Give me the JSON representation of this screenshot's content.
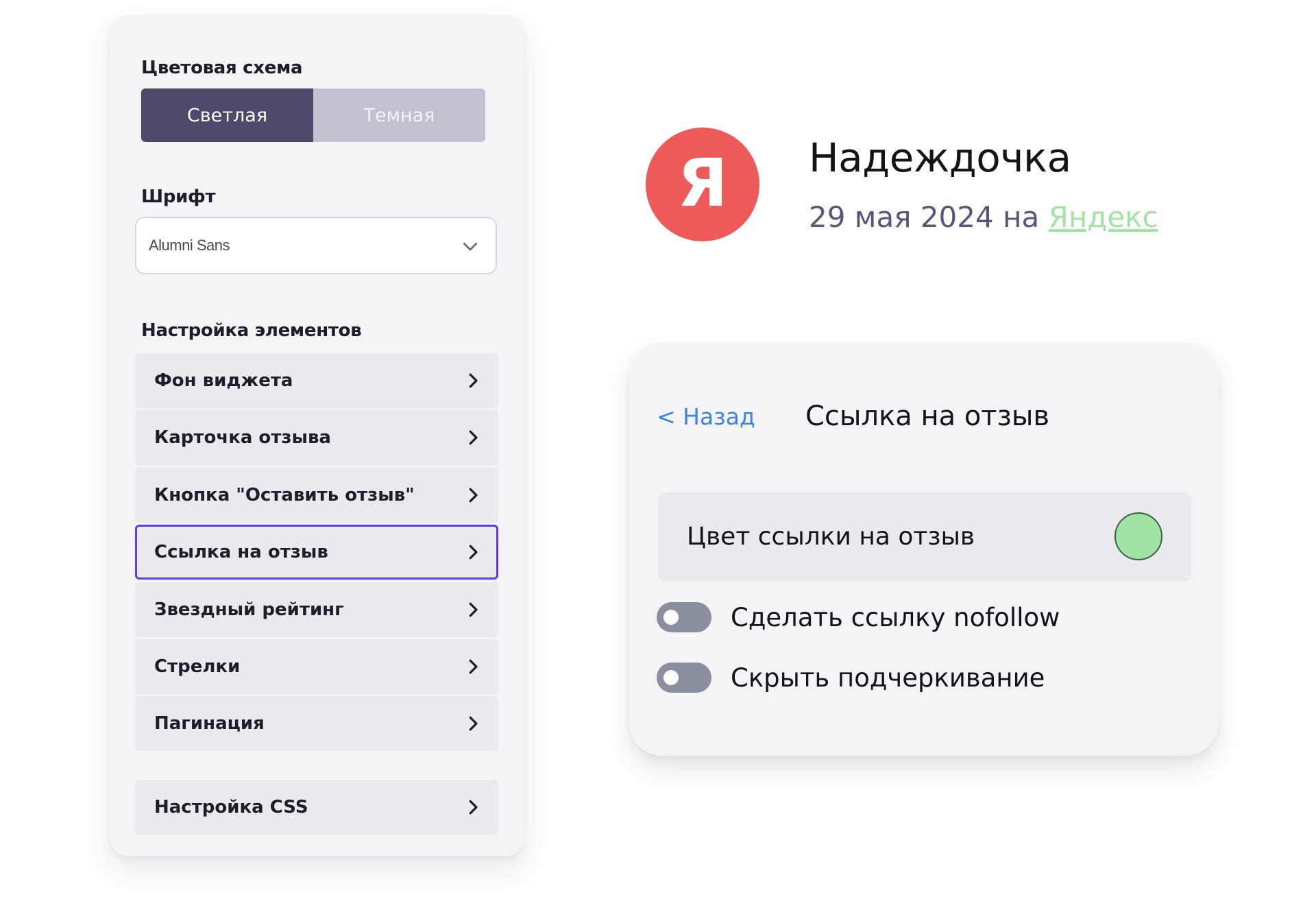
{
  "settings": {
    "color_scheme_label": "Цветовая схема",
    "scheme_options": [
      "Светлая",
      "Темная"
    ],
    "font_label": "Шрифт",
    "font_value": "Alumni Sans",
    "elements_label": "Настройка элементов",
    "items": [
      {
        "label": "Фон виджета",
        "selected": false
      },
      {
        "label": "Карточка отзыва",
        "selected": false
      },
      {
        "label": "Кнопка \"Оставить отзыв\"",
        "selected": false
      },
      {
        "label": "Ссылка на отзыв",
        "selected": true
      },
      {
        "label": "Звездный рейтинг",
        "selected": false
      },
      {
        "label": "Стрелки",
        "selected": false
      },
      {
        "label": "Пагинация",
        "selected": false
      }
    ],
    "css_item": "Настройка CSS"
  },
  "review": {
    "avatar_letter": "Я",
    "name": "Надеждочка",
    "date": "29 мая 2024",
    "on_word": "на",
    "source": "Яндекс"
  },
  "link_panel": {
    "back_label": "< Назад",
    "title": "Ссылка на отзыв",
    "color_label": "Цвет ссылки на отзыв",
    "toggles": [
      {
        "label": "Сделать ссылку nofollow",
        "on": false
      },
      {
        "label": "Скрыть подчеркивание",
        "on": false
      }
    ]
  },
  "colors": {
    "accent_dark": "#4d4a6b",
    "selection_border": "#5b3de0",
    "avatar_bg": "#ee5a5a",
    "link_color": "#a0e3a3",
    "back_link": "#3e82ec"
  },
  "icons": {
    "dropdown": "chevron-down-icon",
    "menu_arrow": "chevron-right-icon"
  }
}
